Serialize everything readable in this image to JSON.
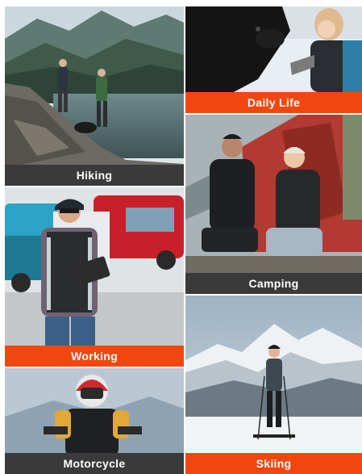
{
  "colors": {
    "label_dark": "#3a3a3a",
    "label_accent": "#f1470f",
    "label_text": "#ffffff"
  },
  "tiles": [
    {
      "id": "hiking",
      "label": "Hiking",
      "style": "dark"
    },
    {
      "id": "daily-life",
      "label": "Daily Life",
      "style": "orange"
    },
    {
      "id": "camping",
      "label": "Camping",
      "style": "dark"
    },
    {
      "id": "working",
      "label": "Working",
      "style": "orange"
    },
    {
      "id": "skiing",
      "label": "Skiing",
      "style": "orange"
    },
    {
      "id": "motorcycle",
      "label": "Motorcycle",
      "style": "dark"
    }
  ]
}
